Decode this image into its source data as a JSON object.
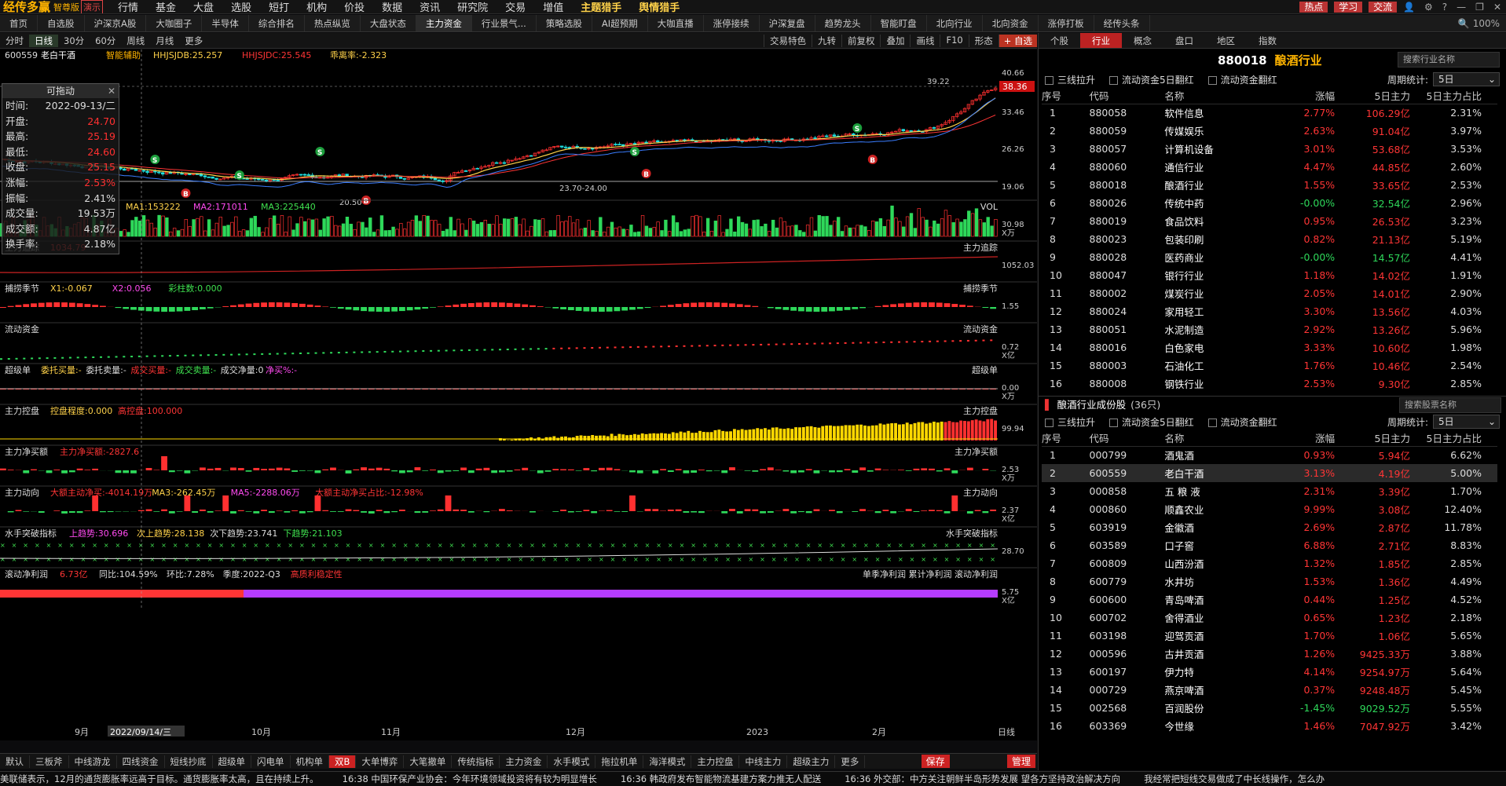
{
  "titlebar": {
    "app_name": "经传多赢",
    "edition": "智尊版",
    "demo_badge": "演示",
    "menus": [
      "行情",
      "基金",
      "大盘",
      "选股",
      "短打",
      "机构",
      "价投",
      "数据",
      "资讯",
      "研究院",
      "交易",
      "增值",
      "主题猎手",
      "舆情猎手"
    ],
    "buttons": [
      "热点",
      "学习",
      "交流"
    ],
    "zoom": "100%"
  },
  "tabs": [
    "首页",
    "自选股",
    "沪深京A股",
    "大咖圈子",
    "半导体",
    "综合排名",
    "热点纵览",
    "大盘状态",
    "主力资金",
    "行业景气...",
    "策略选股",
    "AI超预期",
    "大咖直播",
    "涨停接续",
    "沪深复盘",
    "趋势龙头",
    "智能盯盘",
    "北向行业",
    "北向资金",
    "涨停打板",
    "经传头条"
  ],
  "active_tab": "主力资金",
  "toolbar": {
    "periods": [
      "分时",
      "日线",
      "30分",
      "60分",
      "周线",
      "月线",
      "更多"
    ],
    "active_period": "日线",
    "right": [
      "交易特色",
      "九转",
      "前复权",
      "叠加",
      "画线",
      "F10",
      "形态"
    ],
    "add_btn": "+ 自选"
  },
  "stock": {
    "code": "600559",
    "name": "老白干酒",
    "assist": "智能辅助",
    "ind1": "HHJSJDB:25.257",
    "ind2": "HHJSJDC:25.545",
    "ind3": "乖离率:-2.323",
    "price_labels": [
      "40.66",
      "33.46",
      "26.26",
      "19.06"
    ],
    "last_price": "38.36",
    "high_mark": "39.22",
    "low_mark1": "20.50",
    "low_mark2": "23.70-24.00"
  },
  "tooltip": {
    "title": "可拖动",
    "rows": [
      {
        "k": "时间:",
        "v": "2022-09-13/二",
        "c": ""
      },
      {
        "k": "开盘:",
        "v": "24.70",
        "c": "red"
      },
      {
        "k": "最高:",
        "v": "25.19",
        "c": "red"
      },
      {
        "k": "最低:",
        "v": "24.60",
        "c": "red"
      },
      {
        "k": "收盘:",
        "v": "25.15",
        "c": "red"
      },
      {
        "k": "涨幅:",
        "v": "2.53%",
        "c": "red"
      },
      {
        "k": "振幅:",
        "v": "2.41%",
        "c": ""
      },
      {
        "k": "成交量:",
        "v": "19.53万",
        "c": ""
      },
      {
        "k": "成交额:",
        "v": "4.87亿",
        "c": ""
      },
      {
        "k": "换手率:",
        "v": "2.18%",
        "c": ""
      }
    ]
  },
  "panels": [
    {
      "title": "",
      "legend": [
        {
          "t": "MA1:153222",
          "c": "#ffd24a"
        },
        {
          "t": "MA2:171011",
          "c": "#ff4af0"
        },
        {
          "t": "MA3:225440",
          "c": "#3fe04f"
        }
      ],
      "right": "VOL",
      "axis": [
        "30.98",
        "X万"
      ]
    },
    {
      "title": "主力追踪",
      "legend": [
        {
          "t": "1034.79",
          "c": "#ff3535"
        }
      ],
      "right": "主力追踪",
      "axis": [
        "1052.03",
        ""
      ]
    },
    {
      "title": "捕捞季节",
      "legend": [
        {
          "t": "X1:-0.067",
          "c": "#ffd24a"
        },
        {
          "t": "X2:0.056",
          "c": "#ff4af0"
        },
        {
          "t": "彩柱数:0.000",
          "c": "#3fe04f"
        }
      ],
      "right": "捕捞季节",
      "axis": [
        "1.55",
        ""
      ]
    },
    {
      "title": "流动资金",
      "legend": [],
      "right": "流动资金",
      "axis": [
        "0.72",
        "X亿"
      ]
    },
    {
      "title": "超级单",
      "legend": [
        {
          "t": "委托买量:-",
          "c": "#ffd24a"
        },
        {
          "t": "委托卖量:-",
          "c": "#ddd"
        },
        {
          "t": "成交买量:-",
          "c": "#ff3535"
        },
        {
          "t": "成交卖量:-",
          "c": "#3fe04f"
        },
        {
          "t": "成交净量:0",
          "c": "#ddd"
        },
        {
          "t": "净买%:-",
          "c": "#ff4af0"
        }
      ],
      "right": "超级单",
      "axis": [
        "0.00",
        "X万"
      ]
    },
    {
      "title": "主力控盘",
      "legend": [
        {
          "t": "控盘程度:0.000",
          "c": "#ffd24a"
        },
        {
          "t": "高控盘:100.000",
          "c": "#ff3535"
        }
      ],
      "right": "主力控盘",
      "axis": [
        "99.94",
        ""
      ]
    },
    {
      "title": "主力净买额",
      "legend": [
        {
          "t": "主力净买额:-2827.6",
          "c": "#ff3535"
        }
      ],
      "right": "主力净买额",
      "axis": [
        "2.53",
        "X万"
      ]
    },
    {
      "title": "主力动向",
      "legend": [
        {
          "t": "大额主动净买:-4014.19万",
          "c": "#ff3535"
        },
        {
          "t": "MA3:-262.45万",
          "c": "#ffd24a"
        },
        {
          "t": "MA5:-2288.06万",
          "c": "#ff4af0"
        },
        {
          "t": "大额主动净买占比:-12.98%",
          "c": "#ff3535"
        }
      ],
      "right": "主力动向",
      "axis": [
        "2.37",
        "X亿"
      ]
    },
    {
      "title": "水手突破指标",
      "legend": [
        {
          "t": "上趋势:30.696",
          "c": "#ff4af0"
        },
        {
          "t": "次上趋势:28.138",
          "c": "#ffd24a"
        },
        {
          "t": "次下趋势:23.741",
          "c": "#ddd"
        },
        {
          "t": "下趋势:21.103",
          "c": "#3fe04f"
        }
      ],
      "right": "水手突破指标",
      "axis": [
        "28.70",
        ""
      ]
    },
    {
      "title": "滚动净利润",
      "legend": [
        {
          "t": "6.73亿",
          "c": "#ff3535"
        },
        {
          "t": "同比:104.59%",
          "c": "#ddd"
        },
        {
          "t": "环比:7.28%",
          "c": "#ddd"
        },
        {
          "t": "季度:2022-Q3",
          "c": "#ddd"
        },
        {
          "t": "高质利稳定性",
          "c": "#ff3535"
        }
      ],
      "right": "单季净利润  累计净利润  滚动净利润",
      "axis": [
        "5.75",
        "X亿"
      ]
    }
  ],
  "xaxis": [
    "9月",
    "2022/09/14/三",
    "10月",
    "11月",
    "12月",
    "2023",
    "2月",
    "日线"
  ],
  "bottom_tabs": [
    "默认",
    "三板斧",
    "中线游龙",
    "四线资金",
    "短线抄底",
    "超级单",
    "闪电单",
    "机构单",
    "双B",
    "大单博弈",
    "大笔撤单",
    "传统指标",
    "主力资金",
    "水手模式",
    "拖拉机单",
    "海洋模式",
    "主力控盘",
    "中线主力",
    "超级主力",
    "更多"
  ],
  "active_bottom": "双B",
  "bottom_right": [
    "保存",
    "管理"
  ],
  "ticker": [
    "美联储表示，12月的通货膨胀率远高于目标。通货膨胀率太高，且在持续上升。",
    "16:38 中国环保产业协会：今年环境领域投资将有较为明显增长",
    "16:36 韩政府发布智能物流基建方案力推无人配送",
    "16:36 外交部：中方关注朝鲜半岛形势发展 望各方坚持政治解决方向",
    "我经常把短线交易做成了中长线操作，怎么办"
  ],
  "side": {
    "tabs": [
      "个股",
      "行业",
      "概念",
      "盘口",
      "地区",
      "指数"
    ],
    "active": "行业",
    "code": "880018",
    "name": "酿酒行业",
    "search1": "搜索行业名称",
    "filters": [
      "三线拉升",
      "流动资金5日翻红",
      "流动资金翻红"
    ],
    "period_label": "周期统计:",
    "period_val": "5日",
    "cols": [
      "序号",
      "代码",
      "名称",
      "涨幅",
      "5日主力",
      "5日主力占比"
    ],
    "industries": [
      [
        "1",
        "880058",
        "软件信息",
        "2.77%",
        "106.29亿",
        "2.31%"
      ],
      [
        "2",
        "880059",
        "传媒娱乐",
        "2.63%",
        "91.04亿",
        "3.97%"
      ],
      [
        "3",
        "880057",
        "计算机设备",
        "3.01%",
        "53.68亿",
        "3.53%"
      ],
      [
        "4",
        "880060",
        "通信行业",
        "4.47%",
        "44.85亿",
        "2.60%"
      ],
      [
        "5",
        "880018",
        "酿酒行业",
        "1.55%",
        "33.65亿",
        "2.53%"
      ],
      [
        "6",
        "880026",
        "传统中药",
        "-0.00%",
        "32.54亿",
        "2.96%"
      ],
      [
        "7",
        "880019",
        "食品饮料",
        "0.95%",
        "26.53亿",
        "3.23%"
      ],
      [
        "8",
        "880023",
        "包装印刷",
        "0.82%",
        "21.13亿",
        "5.19%"
      ],
      [
        "9",
        "880028",
        "医药商业",
        "-0.00%",
        "14.57亿",
        "4.41%"
      ],
      [
        "10",
        "880047",
        "银行行业",
        "1.18%",
        "14.02亿",
        "1.91%"
      ],
      [
        "11",
        "880002",
        "煤炭行业",
        "2.05%",
        "14.01亿",
        "2.90%"
      ],
      [
        "12",
        "880024",
        "家用轻工",
        "3.30%",
        "13.56亿",
        "4.03%"
      ],
      [
        "13",
        "880051",
        "水泥制造",
        "2.92%",
        "13.26亿",
        "5.96%"
      ],
      [
        "14",
        "880016",
        "白色家电",
        "3.33%",
        "10.60亿",
        "1.98%"
      ],
      [
        "15",
        "880003",
        "石油化工",
        "1.76%",
        "10.46亿",
        "2.54%"
      ],
      [
        "16",
        "880008",
        "钢铁行业",
        "2.53%",
        "9.30亿",
        "2.85%"
      ]
    ],
    "sec2_title": "酿酒行业成份股",
    "sec2_count": "(36只)",
    "search2": "搜索股票名称",
    "stocks": [
      [
        "1",
        "000799",
        "酒鬼酒",
        "0.93%",
        "5.94亿",
        "6.62%"
      ],
      [
        "2",
        "600559",
        "老白干酒",
        "3.13%",
        "4.19亿",
        "5.00%"
      ],
      [
        "3",
        "000858",
        "五 粮 液",
        "2.31%",
        "3.39亿",
        "1.70%"
      ],
      [
        "4",
        "000860",
        "顺鑫农业",
        "9.99%",
        "3.08亿",
        "12.40%"
      ],
      [
        "5",
        "603919",
        "金徽酒",
        "2.69%",
        "2.87亿",
        "11.78%"
      ],
      [
        "6",
        "603589",
        "口子窖",
        "6.88%",
        "2.71亿",
        "8.83%"
      ],
      [
        "7",
        "600809",
        "山西汾酒",
        "1.32%",
        "1.85亿",
        "2.85%"
      ],
      [
        "8",
        "600779",
        "水井坊",
        "1.53%",
        "1.36亿",
        "4.49%"
      ],
      [
        "9",
        "600600",
        "青岛啤酒",
        "0.44%",
        "1.25亿",
        "4.52%"
      ],
      [
        "10",
        "600702",
        "舍得酒业",
        "0.65%",
        "1.23亿",
        "2.18%"
      ],
      [
        "11",
        "603198",
        "迎驾贡酒",
        "1.70%",
        "1.06亿",
        "5.65%"
      ],
      [
        "12",
        "000596",
        "古井贡酒",
        "1.26%",
        "9425.33万",
        "3.88%"
      ],
      [
        "13",
        "600197",
        "伊力特",
        "4.14%",
        "9254.97万",
        "5.64%"
      ],
      [
        "14",
        "000729",
        "燕京啤酒",
        "0.37%",
        "9248.48万",
        "5.45%"
      ],
      [
        "15",
        "002568",
        "百润股份",
        "-1.45%",
        "9029.52万",
        "5.55%"
      ],
      [
        "16",
        "603369",
        "今世缘",
        "1.46%",
        "7047.92万",
        "3.42%"
      ]
    ],
    "selected_stock": "600559"
  },
  "colors": {
    "up": "#ff3535",
    "down": "#2ed85a",
    "accent": "#ffb400"
  }
}
